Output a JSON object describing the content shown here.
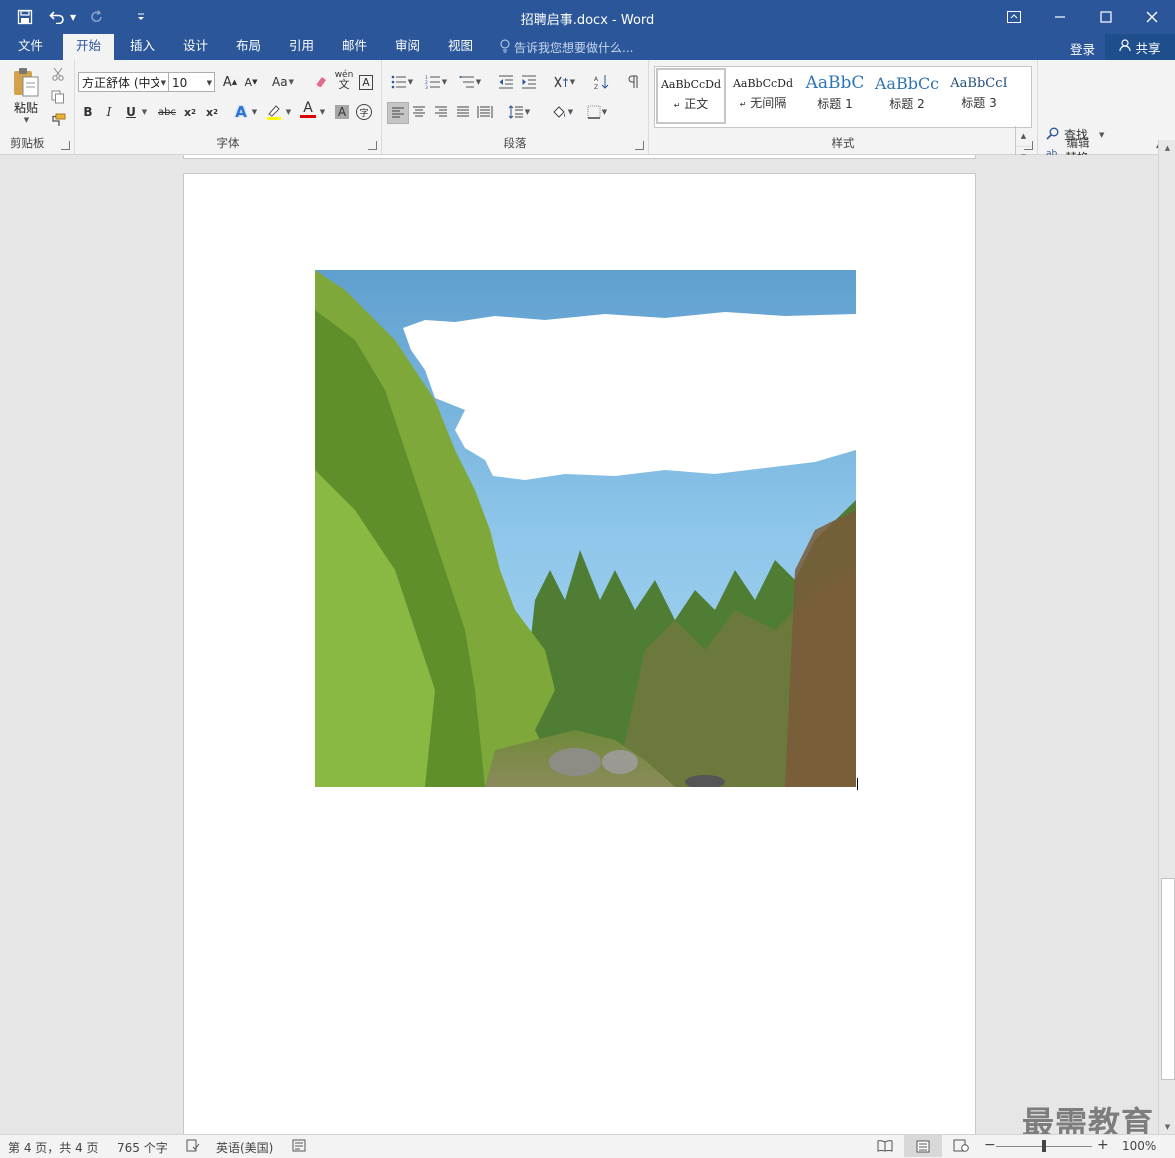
{
  "window": {
    "title": "招聘启事.docx - Word",
    "quick_access": [
      "save-icon",
      "undo-icon",
      "redo-icon",
      "customize-icon"
    ],
    "controls": [
      "ribbon-display-icon",
      "minimize-icon",
      "maximize-icon",
      "close-icon"
    ]
  },
  "tabs": [
    "文件",
    "开始",
    "插入",
    "设计",
    "布局",
    "引用",
    "邮件",
    "审阅",
    "视图"
  ],
  "active_tab": "开始",
  "tell_me": "告诉我您想要做什么...",
  "account": {
    "login": "登录",
    "share": "共享"
  },
  "ribbon": {
    "clipboard": {
      "label": "剪贴板",
      "paste": "粘贴"
    },
    "font": {
      "label": "字体",
      "font_name": "方正舒体 (中文",
      "font_size": "10",
      "case_button": "Aa"
    },
    "paragraph": {
      "label": "段落"
    },
    "styles": {
      "label": "样式",
      "items": [
        {
          "preview": "AaBbCcDd",
          "name": "正文",
          "selected": true
        },
        {
          "preview": "AaBbCcDd",
          "name": "无间隔",
          "selected": false
        },
        {
          "preview": "AaBbC",
          "name": "标题 1",
          "selected": false
        },
        {
          "preview": "AaBbCc",
          "name": "标题 2",
          "selected": false
        },
        {
          "preview": "AaBbCcI",
          "name": "标题 3",
          "selected": false
        }
      ]
    },
    "editing": {
      "label": "编辑",
      "find": "查找",
      "replace": "替换",
      "select": "选择"
    }
  },
  "document": {
    "picture_description_icon": "landscape-picture"
  },
  "status": {
    "page": "第 4 页，共 4 页",
    "words": "765 个字",
    "language": "英语(美国)",
    "zoom": "100%",
    "zoom_level": 100
  },
  "watermark": "最需教育",
  "colors": {
    "brand": "#2b579a",
    "ribbon_bg": "#f3f3f3",
    "doc_bg": "#e6e6e6"
  }
}
